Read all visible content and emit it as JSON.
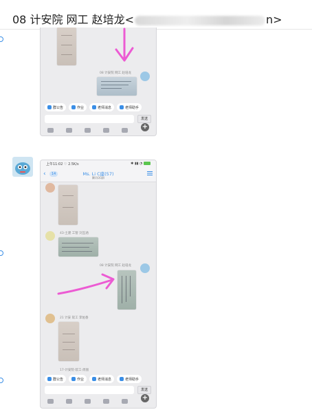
{
  "header": {
    "title_prefix": "08 计安院 网工 赵培龙<",
    "title_suffix": "n>"
  },
  "shot1": {
    "sender_label": "08 计安院 网工 赵培龙",
    "chips": [
      {
        "label": "群公告",
        "icon": "megaphone-icon"
      },
      {
        "label": "作业",
        "icon": "document-icon"
      },
      {
        "label": "老师消息",
        "icon": "message-icon"
      },
      {
        "label": "老师助手",
        "icon": "helper-icon"
      }
    ],
    "send_label": "发送"
  },
  "shot2": {
    "status_time": "上午11:02",
    "status_speed": "2.5K/s",
    "back_count": "14",
    "chat_title": "Ms. Li C座(57)",
    "chat_subtitle": "腾讯QQ群",
    "sender1": "43-土建 工管 刘玉涵",
    "sender2": "08 计安院 网工 赵培龙",
    "sender3": "21 计安 软工 李佑香",
    "sender4": "17-计安院-软工-周丽",
    "chips": [
      {
        "label": "群公告",
        "icon": "megaphone-icon"
      },
      {
        "label": "作业",
        "icon": "document-icon"
      },
      {
        "label": "老师消息",
        "icon": "message-icon"
      },
      {
        "label": "老师助手",
        "icon": "helper-icon"
      }
    ],
    "send_label": "发送"
  },
  "colors": {
    "accent": "#3a8ee6",
    "arrow": "#ec5bd3"
  }
}
